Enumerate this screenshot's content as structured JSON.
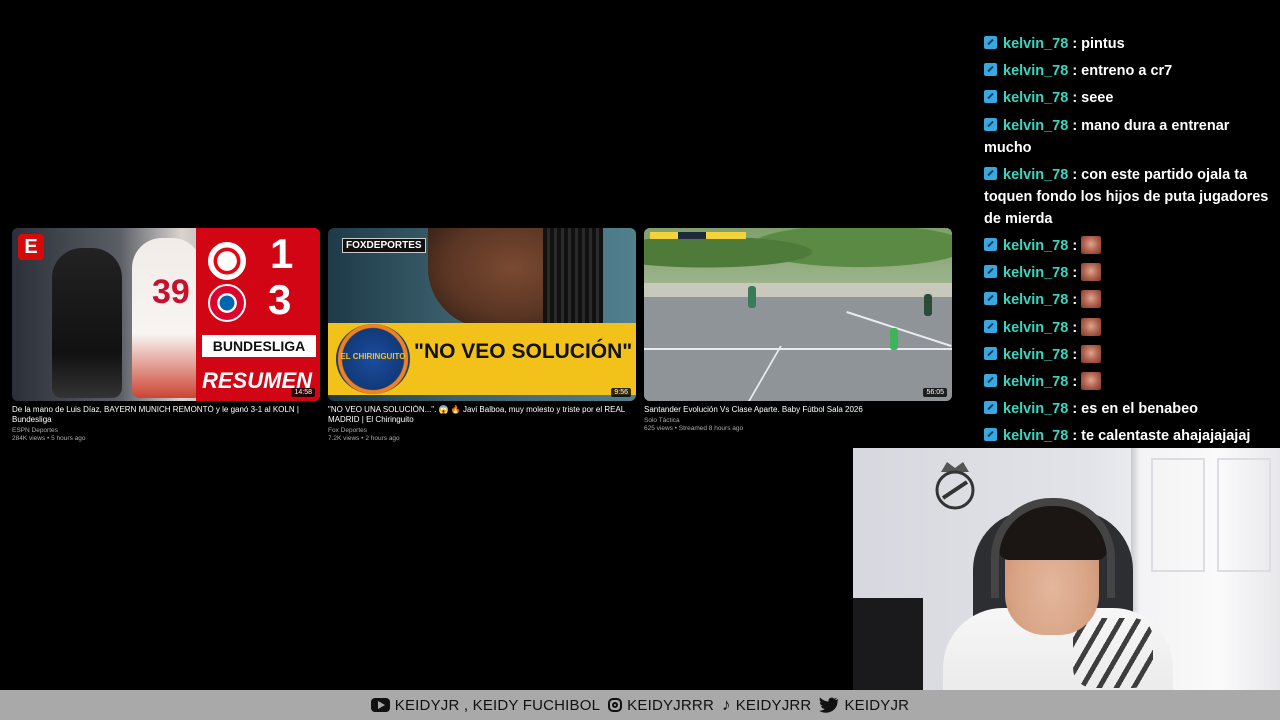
{
  "videos": [
    {
      "title": "De la mano de Luis Díaz, BAYERN MUNICH REMONTÓ y le ganó 3-1 al KOLN | Bundesliga",
      "channel": "ESPN Deportes",
      "views": "284K views",
      "age": "5 hours ago",
      "duration": "14:58",
      "thumb": {
        "jersey_number": "39",
        "score_home": "1",
        "score_away": "3",
        "league": "BUNDESLIGA",
        "caption": "RESUMEN"
      }
    },
    {
      "title": "\"NO VEO UNA SOLUCIÓN...\". 😱 🔥 Javi Balboa, muy molesto y triste por el REAL MADRID | El Chiringuito",
      "channel": "Fox Deportes",
      "views": "7.2K views",
      "age": "2 hours ago",
      "duration": "9:56",
      "thumb": {
        "network": "FOXDEPORTES",
        "badge": "EL CHIRINGUITO",
        "quote": "\"NO VEO SOLUCIÓN\""
      }
    },
    {
      "title": "Santander Evolución Vs Clase Aparte. Baby Fútbol Sala 2026",
      "channel": "Solo Táctica",
      "views": "625 views",
      "age": "Streamed 8 hours ago",
      "duration": "56:05",
      "thumb": {}
    }
  ],
  "chat": [
    {
      "user": "kelvin_78",
      "text": "pintus",
      "emote": false
    },
    {
      "user": "kelvin_78",
      "text": "entreno a cr7",
      "emote": false
    },
    {
      "user": "kelvin_78",
      "text": "seee",
      "emote": false
    },
    {
      "user": "kelvin_78",
      "text": "mano dura a entrenar mucho",
      "emote": false
    },
    {
      "user": "kelvin_78",
      "text": "con este partido ojala ta toquen fondo los hijos de puta jugadores de mierda",
      "emote": false
    },
    {
      "user": "kelvin_78",
      "text": "",
      "emote": true
    },
    {
      "user": "kelvin_78",
      "text": "",
      "emote": true
    },
    {
      "user": "kelvin_78",
      "text": "",
      "emote": true
    },
    {
      "user": "kelvin_78",
      "text": "",
      "emote": true
    },
    {
      "user": "kelvin_78",
      "text": "",
      "emote": true
    },
    {
      "user": "kelvin_78",
      "text": "",
      "emote": true
    },
    {
      "user": "kelvin_78",
      "text": "es en el benabeo",
      "emote": false
    },
    {
      "user": "kelvin_78",
      "text": "te calentaste ahajajajajaj",
      "emote": false
    }
  ],
  "chat_separator": ":",
  "socials": {
    "youtube": "KEIDYJR , KEIDY FUCHIBOL",
    "instagram": "KEIDYJRRR",
    "tiktok": "KEIDYJRR",
    "twitter": "KEIDYJR"
  },
  "colors": {
    "chat_username": "#3ad6c0",
    "chat_badge": "#3aa7e0",
    "bottom_bar": "#a9a9a9",
    "background": "#000000"
  }
}
